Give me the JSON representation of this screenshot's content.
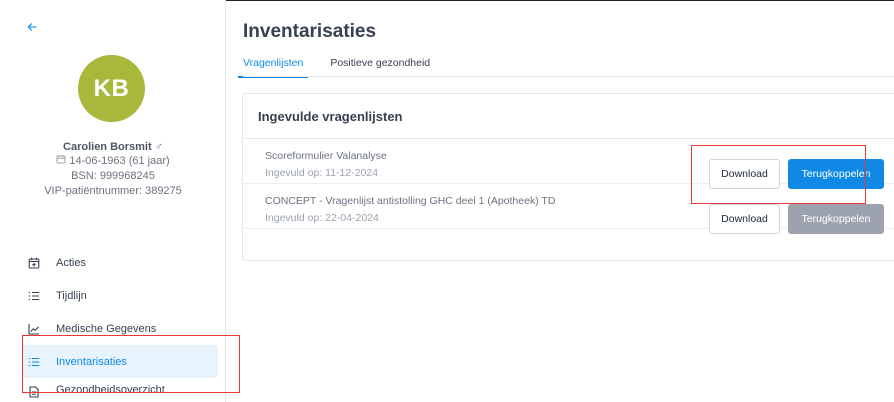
{
  "sidebar": {
    "back_icon": "arrow-left-icon",
    "avatar_initials": "KB",
    "avatar_color": "#a8b83a",
    "patient": {
      "name": "Carolien Borsmit",
      "sex_symbol": "♂",
      "birthdate": "14-06-1963",
      "age": "(61 jaar)",
      "bsn": "BSN: 999968245",
      "vip": "VIP-patiëntnummer: 389275"
    },
    "items": [
      {
        "label": "Acties",
        "icon": "calendar-plus-icon"
      },
      {
        "label": "Tijdlijn",
        "icon": "list-icon"
      },
      {
        "label": "Medische Gegevens",
        "icon": "chart-line-icon"
      },
      {
        "label": "Inventarisaties",
        "icon": "numbered-list-icon",
        "active": true
      },
      {
        "label": "Gezondheidsoverzicht",
        "icon": "document-icon"
      }
    ]
  },
  "main": {
    "title": "Inventarisaties",
    "tabs": [
      {
        "label": "Vragenlijsten",
        "active": true
      },
      {
        "label": "Positieve gezondheid",
        "active": false
      }
    ],
    "panel": {
      "title": "Ingevulde vragenlijsten",
      "rows": [
        {
          "title": "Scoreformulier Valanalyse",
          "subtitle": "Ingevuld op: 11-12-2024",
          "download_label": "Download",
          "link_label": "Terugkoppelen",
          "link_enabled": true
        },
        {
          "title": "CONCEPT - Vragenlijst antistolling GHC deel 1 (Apotheek) TD",
          "subtitle": "Ingevuld op: 22-04-2024",
          "download_label": "Download",
          "link_label": "Terugkoppelen",
          "link_enabled": false
        }
      ]
    }
  },
  "colors": {
    "accent": "#1089e6",
    "active_bg": "#e8f4fd",
    "disabled_button": "#9ca3af",
    "highlight_box": "#e53935"
  }
}
